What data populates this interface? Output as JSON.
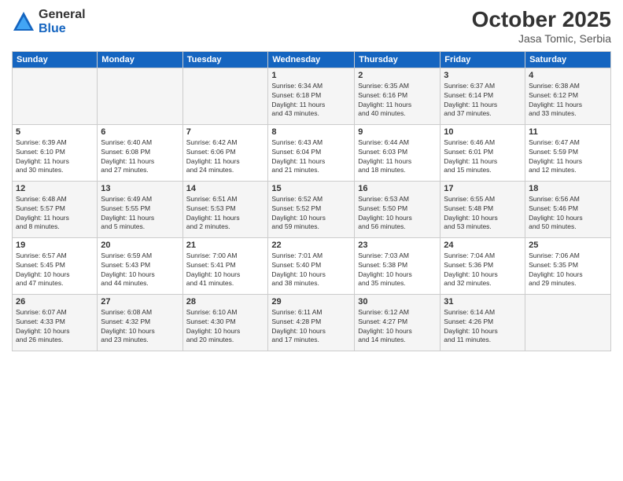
{
  "header": {
    "logo_general": "General",
    "logo_blue": "Blue",
    "month": "October 2025",
    "location": "Jasa Tomic, Serbia"
  },
  "days_of_week": [
    "Sunday",
    "Monday",
    "Tuesday",
    "Wednesday",
    "Thursday",
    "Friday",
    "Saturday"
  ],
  "weeks": [
    [
      {
        "day": "",
        "info": ""
      },
      {
        "day": "",
        "info": ""
      },
      {
        "day": "",
        "info": ""
      },
      {
        "day": "1",
        "info": "Sunrise: 6:34 AM\nSunset: 6:18 PM\nDaylight: 11 hours\nand 43 minutes."
      },
      {
        "day": "2",
        "info": "Sunrise: 6:35 AM\nSunset: 6:16 PM\nDaylight: 11 hours\nand 40 minutes."
      },
      {
        "day": "3",
        "info": "Sunrise: 6:37 AM\nSunset: 6:14 PM\nDaylight: 11 hours\nand 37 minutes."
      },
      {
        "day": "4",
        "info": "Sunrise: 6:38 AM\nSunset: 6:12 PM\nDaylight: 11 hours\nand 33 minutes."
      }
    ],
    [
      {
        "day": "5",
        "info": "Sunrise: 6:39 AM\nSunset: 6:10 PM\nDaylight: 11 hours\nand 30 minutes."
      },
      {
        "day": "6",
        "info": "Sunrise: 6:40 AM\nSunset: 6:08 PM\nDaylight: 11 hours\nand 27 minutes."
      },
      {
        "day": "7",
        "info": "Sunrise: 6:42 AM\nSunset: 6:06 PM\nDaylight: 11 hours\nand 24 minutes."
      },
      {
        "day": "8",
        "info": "Sunrise: 6:43 AM\nSunset: 6:04 PM\nDaylight: 11 hours\nand 21 minutes."
      },
      {
        "day": "9",
        "info": "Sunrise: 6:44 AM\nSunset: 6:03 PM\nDaylight: 11 hours\nand 18 minutes."
      },
      {
        "day": "10",
        "info": "Sunrise: 6:46 AM\nSunset: 6:01 PM\nDaylight: 11 hours\nand 15 minutes."
      },
      {
        "day": "11",
        "info": "Sunrise: 6:47 AM\nSunset: 5:59 PM\nDaylight: 11 hours\nand 12 minutes."
      }
    ],
    [
      {
        "day": "12",
        "info": "Sunrise: 6:48 AM\nSunset: 5:57 PM\nDaylight: 11 hours\nand 8 minutes."
      },
      {
        "day": "13",
        "info": "Sunrise: 6:49 AM\nSunset: 5:55 PM\nDaylight: 11 hours\nand 5 minutes."
      },
      {
        "day": "14",
        "info": "Sunrise: 6:51 AM\nSunset: 5:53 PM\nDaylight: 11 hours\nand 2 minutes."
      },
      {
        "day": "15",
        "info": "Sunrise: 6:52 AM\nSunset: 5:52 PM\nDaylight: 10 hours\nand 59 minutes."
      },
      {
        "day": "16",
        "info": "Sunrise: 6:53 AM\nSunset: 5:50 PM\nDaylight: 10 hours\nand 56 minutes."
      },
      {
        "day": "17",
        "info": "Sunrise: 6:55 AM\nSunset: 5:48 PM\nDaylight: 10 hours\nand 53 minutes."
      },
      {
        "day": "18",
        "info": "Sunrise: 6:56 AM\nSunset: 5:46 PM\nDaylight: 10 hours\nand 50 minutes."
      }
    ],
    [
      {
        "day": "19",
        "info": "Sunrise: 6:57 AM\nSunset: 5:45 PM\nDaylight: 10 hours\nand 47 minutes."
      },
      {
        "day": "20",
        "info": "Sunrise: 6:59 AM\nSunset: 5:43 PM\nDaylight: 10 hours\nand 44 minutes."
      },
      {
        "day": "21",
        "info": "Sunrise: 7:00 AM\nSunset: 5:41 PM\nDaylight: 10 hours\nand 41 minutes."
      },
      {
        "day": "22",
        "info": "Sunrise: 7:01 AM\nSunset: 5:40 PM\nDaylight: 10 hours\nand 38 minutes."
      },
      {
        "day": "23",
        "info": "Sunrise: 7:03 AM\nSunset: 5:38 PM\nDaylight: 10 hours\nand 35 minutes."
      },
      {
        "day": "24",
        "info": "Sunrise: 7:04 AM\nSunset: 5:36 PM\nDaylight: 10 hours\nand 32 minutes."
      },
      {
        "day": "25",
        "info": "Sunrise: 7:06 AM\nSunset: 5:35 PM\nDaylight: 10 hours\nand 29 minutes."
      }
    ],
    [
      {
        "day": "26",
        "info": "Sunrise: 6:07 AM\nSunset: 4:33 PM\nDaylight: 10 hours\nand 26 minutes."
      },
      {
        "day": "27",
        "info": "Sunrise: 6:08 AM\nSunset: 4:32 PM\nDaylight: 10 hours\nand 23 minutes."
      },
      {
        "day": "28",
        "info": "Sunrise: 6:10 AM\nSunset: 4:30 PM\nDaylight: 10 hours\nand 20 minutes."
      },
      {
        "day": "29",
        "info": "Sunrise: 6:11 AM\nSunset: 4:28 PM\nDaylight: 10 hours\nand 17 minutes."
      },
      {
        "day": "30",
        "info": "Sunrise: 6:12 AM\nSunset: 4:27 PM\nDaylight: 10 hours\nand 14 minutes."
      },
      {
        "day": "31",
        "info": "Sunrise: 6:14 AM\nSunset: 4:26 PM\nDaylight: 10 hours\nand 11 minutes."
      },
      {
        "day": "",
        "info": ""
      }
    ]
  ]
}
